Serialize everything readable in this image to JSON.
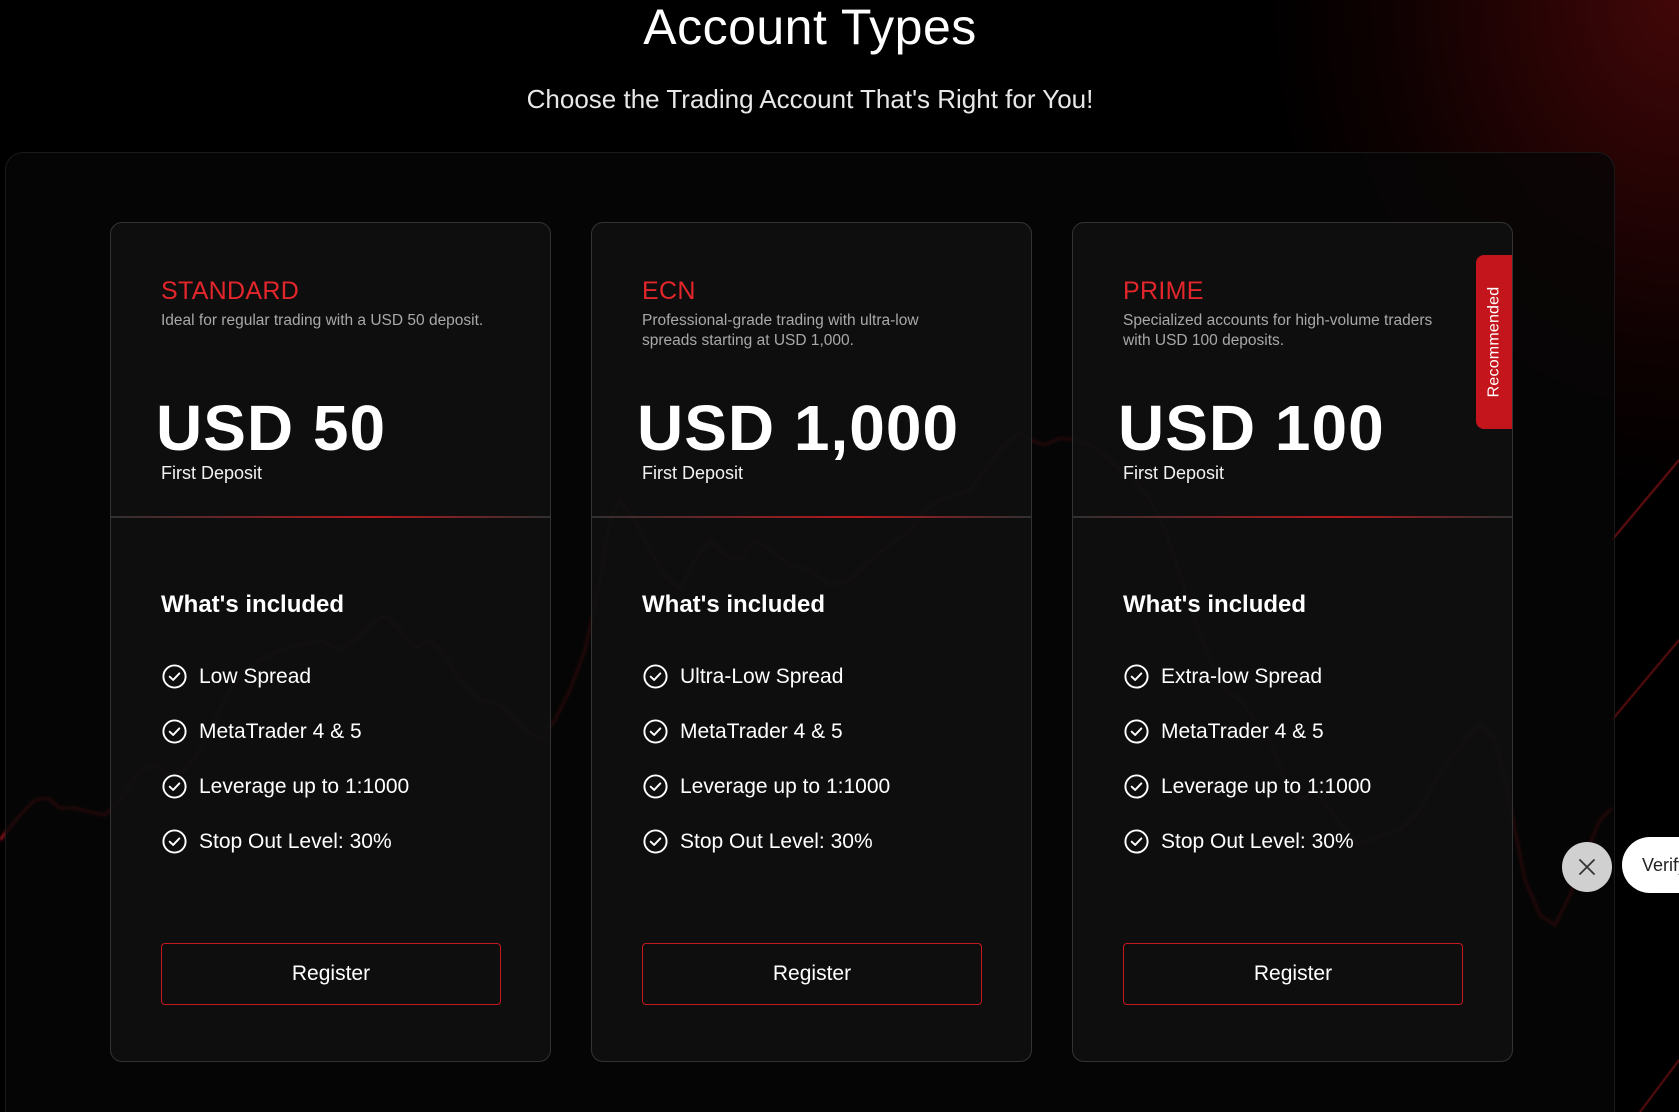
{
  "header": {
    "title": "Account Types",
    "subtitle": "Choose the Trading Account That's Right for You!"
  },
  "colors": {
    "accent": "#e3262b",
    "button_border": "#c3191e",
    "ribbon": "#c3151b",
    "card_bg": "#101010"
  },
  "cards": [
    {
      "name": "STANDARD",
      "description": "Ideal for regular trading with a USD 50 deposit.",
      "price": "USD 50",
      "price_label": "First Deposit",
      "included_heading": "What's included",
      "features": [
        "Low Spread",
        "MetaTrader 4 & 5",
        "Leverage up to 1:1000",
        "Stop Out Level: 30%"
      ],
      "button": "Register"
    },
    {
      "name": "ECN",
      "description": "Professional-grade trading with ultra-low spreads starting at USD 1,000.",
      "price": "USD 1,000",
      "price_label": "First Deposit",
      "included_heading": "What's included",
      "features": [
        "Ultra-Low Spread",
        "MetaTrader 4 & 5",
        "Leverage up to 1:1000",
        "Stop Out Level: 30%"
      ],
      "button": "Register"
    },
    {
      "name": "PRIME",
      "description": "Specialized accounts for high-volume traders with USD 100 deposits.",
      "price": "USD 100",
      "price_label": "First Deposit",
      "included_heading": "What's included",
      "features": [
        "Extra-low Spread",
        "MetaTrader 4 & 5",
        "Leverage up to 1:1000",
        "Stop Out Level: 30%"
      ],
      "button": "Register",
      "badge": "Recommended"
    }
  ],
  "widget": {
    "close_icon": "close-icon",
    "verify_label": "Verify"
  },
  "icons": {
    "feature": "check-circle-icon"
  }
}
